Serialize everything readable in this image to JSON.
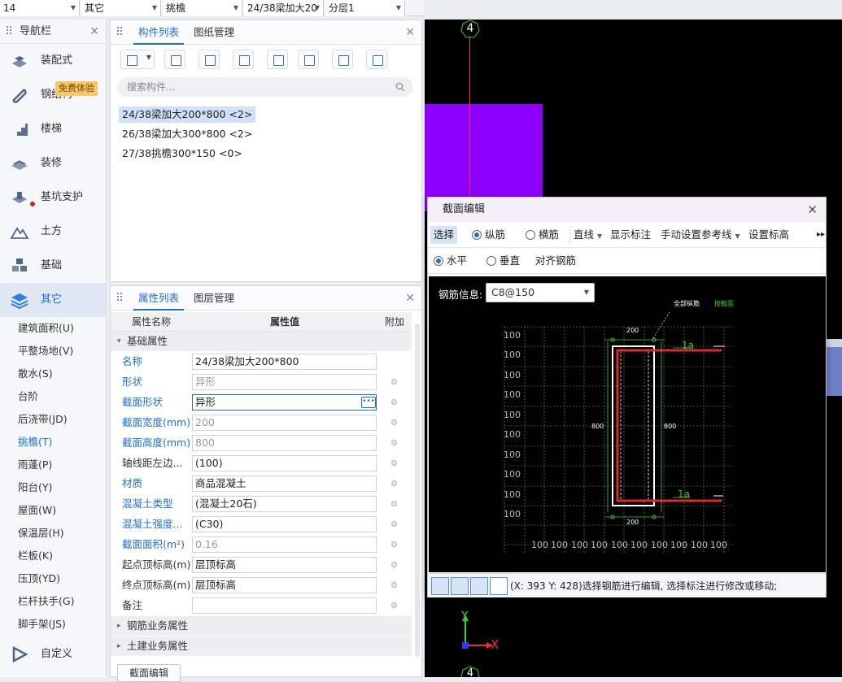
{
  "topbar": {
    "combos": [
      {
        "value": "14"
      },
      {
        "value": "其它"
      },
      {
        "value": "挑檐"
      },
      {
        "value": "24/38梁加大20"
      },
      {
        "value": "分层1"
      }
    ]
  },
  "nav": {
    "title": "导航栏",
    "badge": "免费体验",
    "items": [
      {
        "label": "装配式",
        "icon": "assembly-icon"
      },
      {
        "label": "钢结构",
        "icon": "steel-beam-icon"
      },
      {
        "label": "楼梯",
        "icon": "stairs-icon"
      },
      {
        "label": "装修",
        "icon": "decoration-icon"
      },
      {
        "label": "基坑支护",
        "icon": "pit-support-icon"
      },
      {
        "label": "土方",
        "icon": "earthwork-icon"
      },
      {
        "label": "基础",
        "icon": "foundation-icon"
      },
      {
        "label": "其它",
        "icon": "layers-icon"
      }
    ],
    "sub_items": [
      "建筑面积(U)",
      "平整场地(V)",
      "散水(S)",
      "台阶",
      "后浇带(JD)",
      "挑檐(T)",
      "雨蓬(P)",
      "阳台(Y)",
      "屋面(W)",
      "保温层(H)",
      "栏板(K)",
      "压顶(YD)",
      "栏杆扶手(G)",
      "脚手架(JS)"
    ],
    "custom": "自定义"
  },
  "complist": {
    "tab_active": "构件列表",
    "tab_other": "图纸管理",
    "search_placeholder": "搜索构件...",
    "items": [
      "24/38梁加大200*800 <2>",
      "26/38梁加大300*800 <2>",
      "27/38挑檐300*150 <0>"
    ]
  },
  "props": {
    "tab_active": "属性列表",
    "tab_other": "图层管理",
    "col_name": "属性名称",
    "col_value": "属性值",
    "col_extra": "附加",
    "group_basic": "基础属性",
    "rows": [
      {
        "name": "名称",
        "value": "24/38梁加大200*800"
      },
      {
        "name": "形状",
        "value": "异形"
      },
      {
        "name": "截面形状",
        "value": "异形"
      },
      {
        "name": "截面宽度(mm)",
        "value": "200"
      },
      {
        "name": "截面高度(mm)",
        "value": "800"
      },
      {
        "name": "轴线距左边...",
        "value": "(100)"
      },
      {
        "name": "材质",
        "value": "商品混凝土"
      },
      {
        "name": "混凝土类型",
        "value": "(混凝土20石)"
      },
      {
        "name": "混凝土强度...",
        "value": "(C30)"
      },
      {
        "name": "截面面积(m²)",
        "value": "0.16"
      },
      {
        "name": "起点顶标高(m)",
        "value": "层顶标高"
      },
      {
        "name": "终点顶标高(m)",
        "value": "层顶标高"
      },
      {
        "name": "备注",
        "value": ""
      }
    ],
    "group_rebar": "钢筋业务属性",
    "group_civil": "土建业务属性",
    "bottom_button": "截面编辑"
  },
  "viewport": {
    "axis_label": "4",
    "axis_label_bottom": "4",
    "x_label": "X",
    "y_label": "Y"
  },
  "dialog": {
    "title": "截面编辑",
    "toolbar1": {
      "select": "选择",
      "longitudinal": "纵筋",
      "transverse": "横筋",
      "line": "直线",
      "show_dim": "显示标注",
      "manual_ref": "手动设置参考线",
      "set_elev": "设置标高"
    },
    "toolbar2": {
      "horizontal": "水平",
      "vertical": "垂直",
      "align": "对齐钢筋"
    },
    "rebar_label": "钢筋信息:",
    "rebar_value": "C8@150",
    "drawing": {
      "top_label_all": "全部纵筋",
      "top_label_mode": "按截面",
      "dim_top": "200",
      "dim_bottom": "200",
      "dim_left": "800",
      "dim_right": "800",
      "anchor_top": "1a",
      "anchor_bottom": "1a",
      "grid_label": "100"
    },
    "status_text": "(X: 393 Y: 428)选择钢筋进行编辑, 选择标注进行修改或移动;"
  }
}
